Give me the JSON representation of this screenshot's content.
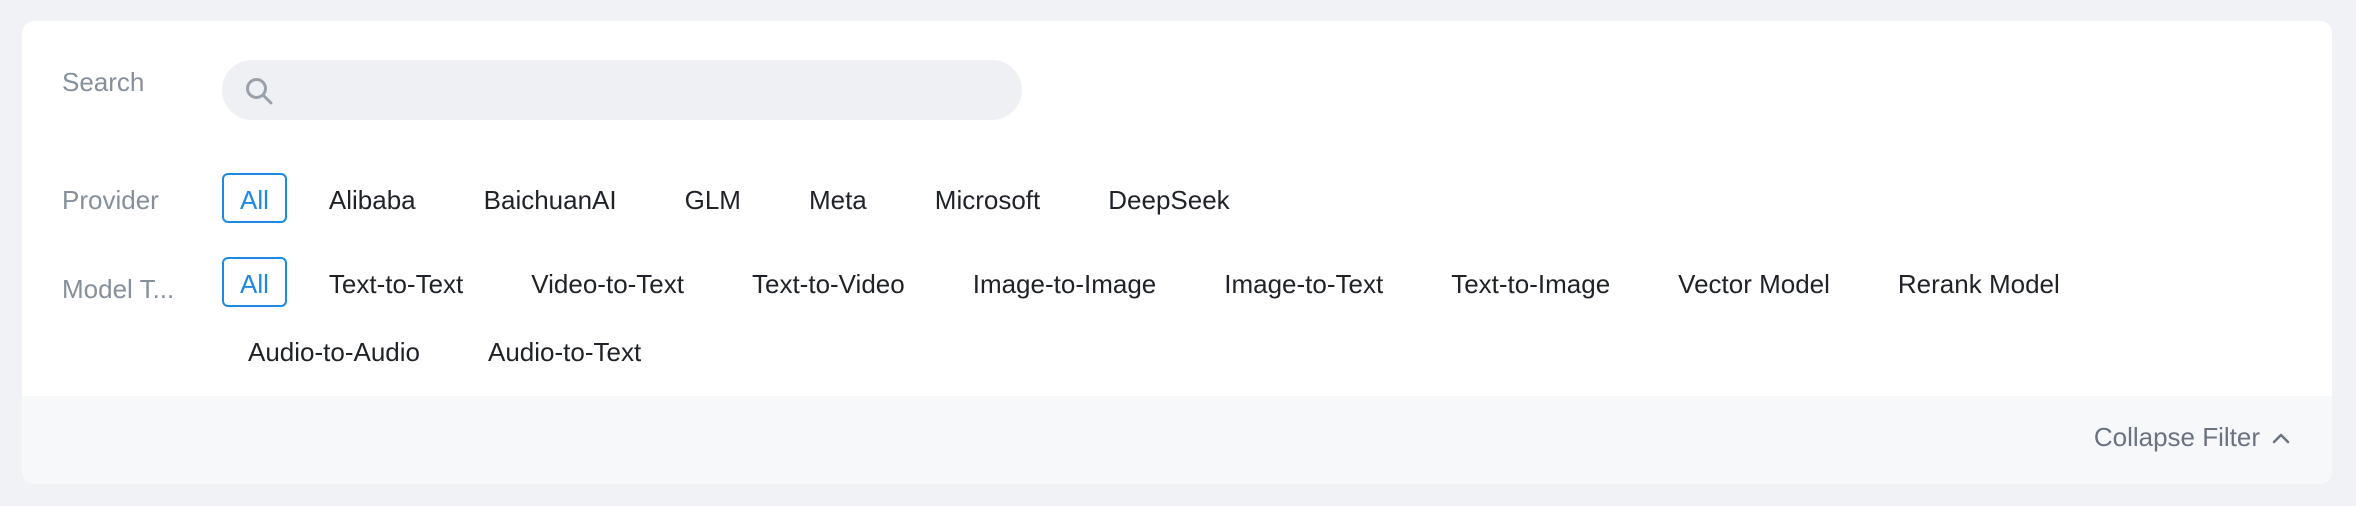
{
  "filter": {
    "search": {
      "label": "Search",
      "value": "",
      "placeholder": ""
    },
    "provider": {
      "label": "Provider",
      "options": [
        "All",
        "Alibaba",
        "BaichuanAI",
        "GLM",
        "Meta",
        "Microsoft",
        "DeepSeek"
      ],
      "selected": "All"
    },
    "model_type": {
      "label": "Model T...",
      "options": [
        "All",
        "Text-to-Text",
        "Video-to-Text",
        "Text-to-Video",
        "Image-to-Image",
        "Image-to-Text",
        "Text-to-Image",
        "Vector Model",
        "Rerank Model",
        "Audio-to-Audio",
        "Audio-to-Text"
      ],
      "selected": "All"
    },
    "collapse_label": "Collapse Filter"
  },
  "icons": {
    "search": "search-icon",
    "collapse": "chevron-up-icon"
  },
  "colors": {
    "accent": "#1e88e5",
    "label": "#86909c",
    "text": "#1f2329"
  }
}
